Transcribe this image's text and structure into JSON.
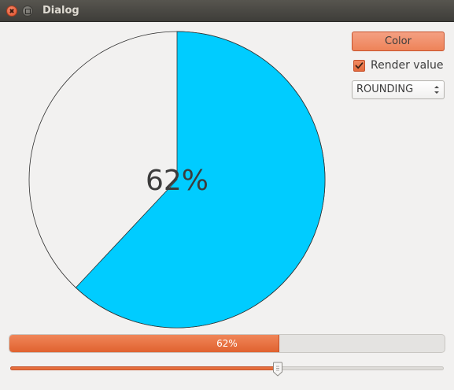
{
  "window": {
    "title": "Dialog"
  },
  "pie": {
    "value_percent": 62,
    "label": "62%",
    "fill_color": "#00ccff",
    "background_color": "#f2f1f0",
    "outline_color": "#303030"
  },
  "controls": {
    "color_button_label": "Color",
    "render_value_label": "Render value",
    "render_value_checked": true,
    "rounding_value": "ROUNDING"
  },
  "progress": {
    "value_percent": 62,
    "label": "62%"
  },
  "slider": {
    "value_percent": 62
  },
  "colors": {
    "accent": "#e9703f",
    "pie_fill": "#00ccff",
    "window_bg": "#f2f1f0",
    "titlebar": "#3e3d39"
  },
  "icons": {
    "close": "close-icon",
    "maximize": "maximize-icon",
    "checkbox": "checkmark-icon",
    "spinner": "spin-arrows-icon",
    "slider_handle": "slider-handle-icon"
  }
}
